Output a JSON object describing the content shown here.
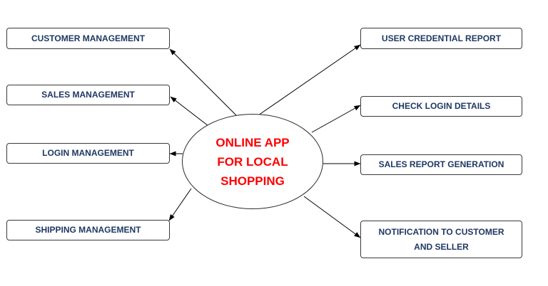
{
  "center": {
    "lines": [
      "ONLINE APP",
      "FOR LOCAL",
      "SHOPPING"
    ],
    "color": "#ff0000"
  },
  "left_nodes": [
    {
      "label": "CUSTOMER MANAGEMENT"
    },
    {
      "label": "SALES MANAGEMENT"
    },
    {
      "label": "LOGIN MANAGEMENT"
    },
    {
      "label": "SHIPPING MANAGEMENT"
    }
  ],
  "right_nodes": [
    {
      "label": "USER CREDENTIAL REPORT"
    },
    {
      "label": "CHECK LOGIN DETAILS"
    },
    {
      "label": "SALES REPORT GENERATION"
    },
    {
      "label_lines": [
        "NOTIFICATION TO CUSTOMER",
        "AND SELLER"
      ]
    }
  ],
  "colors": {
    "node_text": "#1f3864",
    "border": "#3a3a3a",
    "arrow": "#000000"
  }
}
